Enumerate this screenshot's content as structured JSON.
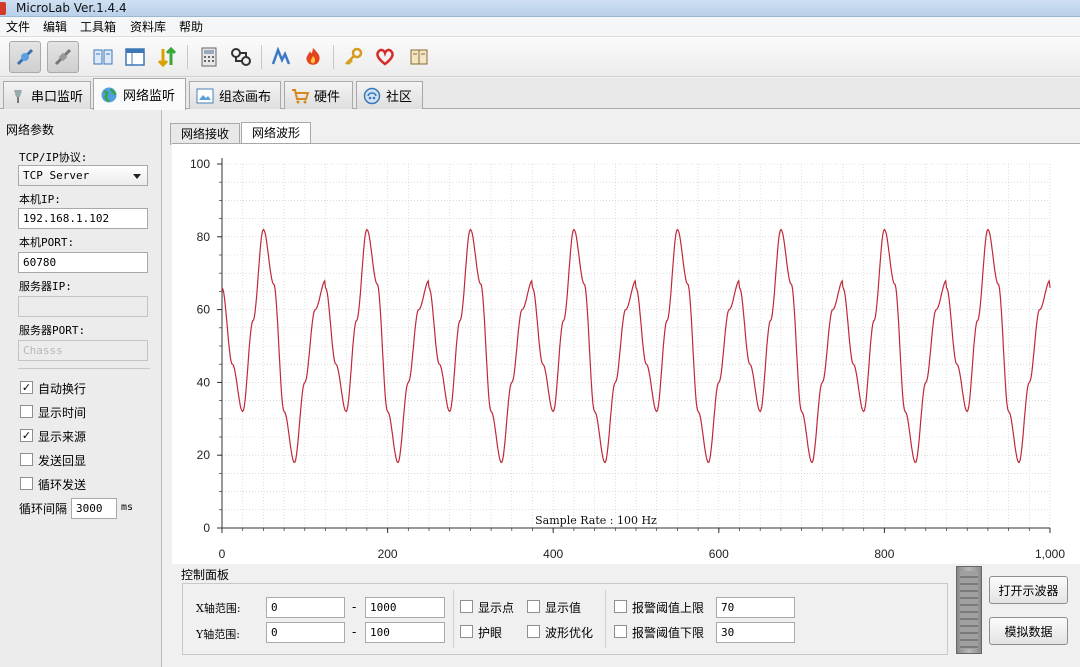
{
  "window": {
    "title": "MicroLab Ver.1.4.4"
  },
  "menu": [
    "文件",
    "编辑",
    "工具箱",
    "资料库",
    "帮助"
  ],
  "toolbar": {
    "icons": [
      "connect-icon",
      "disconnect-icon",
      "columns-icon",
      "window-icon",
      "sort-arrows-icon",
      "calculator-icon",
      "flowchart-icon",
      "signal-icon",
      "fire-icon",
      "key-icon",
      "heart-icon",
      "book-icon"
    ]
  },
  "tabs": {
    "serial": "串口监听",
    "network": "网络监听",
    "canvas": "组态画布",
    "hardware": "硬件",
    "community": "社区"
  },
  "left": {
    "group_title": "网络参数",
    "protocol_label": "TCP/IP协议:",
    "protocol_value": "TCP Server",
    "local_ip_label": "本机IP:",
    "local_ip_value": "192.168.1.102",
    "local_port_label": "本机PORT:",
    "local_port_value": "60780",
    "server_ip_label": "服务器IP:",
    "server_ip_value": "",
    "server_port_label": "服务器PORT:",
    "server_port_value": "Chasss",
    "options": [
      {
        "label": "自动换行",
        "checked": true
      },
      {
        "label": "显示时间",
        "checked": false
      },
      {
        "label": "显示来源",
        "checked": true
      },
      {
        "label": "发送回显",
        "checked": false
      },
      {
        "label": "循环发送",
        "checked": false
      }
    ],
    "check_mark": "✓",
    "interval_label": "循环间隔",
    "interval_value": "3000",
    "interval_unit": "ms"
  },
  "subtabs": {
    "receive": "网络接收",
    "waveform": "网络波形"
  },
  "chart_data": {
    "type": "line",
    "annotation": "Sample Rate : 100 Hz",
    "xlim": [
      0,
      1000
    ],
    "ylim": [
      0,
      100
    ],
    "x_ticks": [
      "0",
      "200",
      "400",
      "600",
      "800",
      "1,000"
    ],
    "y_ticks": [
      "0",
      "20",
      "40",
      "60",
      "80",
      "100"
    ],
    "grid": true,
    "series": [
      {
        "color": "#c0283a",
        "formula_note": "sum of two sines",
        "x": [
          0,
          12.5,
          25,
          37.5,
          50,
          62.5,
          75,
          87.5,
          100,
          112.5,
          125
        ],
        "y": [
          66,
          45,
          32,
          57,
          82,
          67,
          32,
          18,
          40,
          60,
          68
        ],
        "period": 125
      }
    ]
  },
  "control": {
    "title": "控制面板",
    "x_range_label": "X轴范围:",
    "x_min": "0",
    "x_max": "1000",
    "y_range_label": "Y轴范围:",
    "y_min": "0",
    "y_max": "100",
    "dash": "-",
    "show_points": "显示点",
    "show_values": "显示值",
    "eye_care": "护眼",
    "wave_optimize": "波形优化",
    "alarm_upper_label": "报警阈值上限",
    "alarm_upper_value": "70",
    "alarm_lower_label": "报警阈值下限",
    "alarm_lower_value": "30",
    "open_scope": "打开示波器",
    "simulate": "模拟数据"
  }
}
